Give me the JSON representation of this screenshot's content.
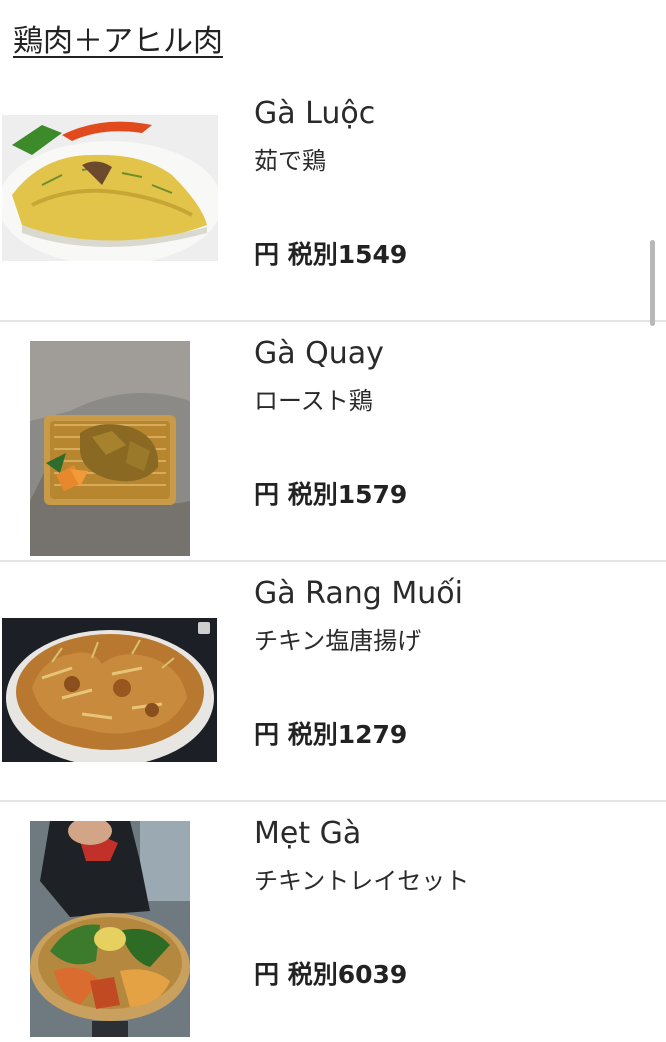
{
  "category": {
    "title": "鶏肉＋アヒル肉"
  },
  "items": [
    {
      "name": "Gà Luộc",
      "subtitle": "茹で鶏",
      "price": "円 税別1549",
      "image": "boiled-chicken-photo"
    },
    {
      "name": "Gà Quay",
      "subtitle": "ロースト鶏",
      "price": "円 税別1579",
      "image": "roast-chicken-photo"
    },
    {
      "name": "Gà Rang Muối",
      "subtitle": "チキン塩唐揚げ",
      "price": "円 税別1279",
      "image": "salt-fried-chicken-photo"
    },
    {
      "name": "Mẹt Gà",
      "subtitle": "チキントレイセット",
      "price": "円 税別6039",
      "image": "chicken-tray-set-photo"
    }
  ],
  "colors": {
    "text": "#222222",
    "divider": "#e4e4e4",
    "scrollbar": "#b8b8b8"
  }
}
